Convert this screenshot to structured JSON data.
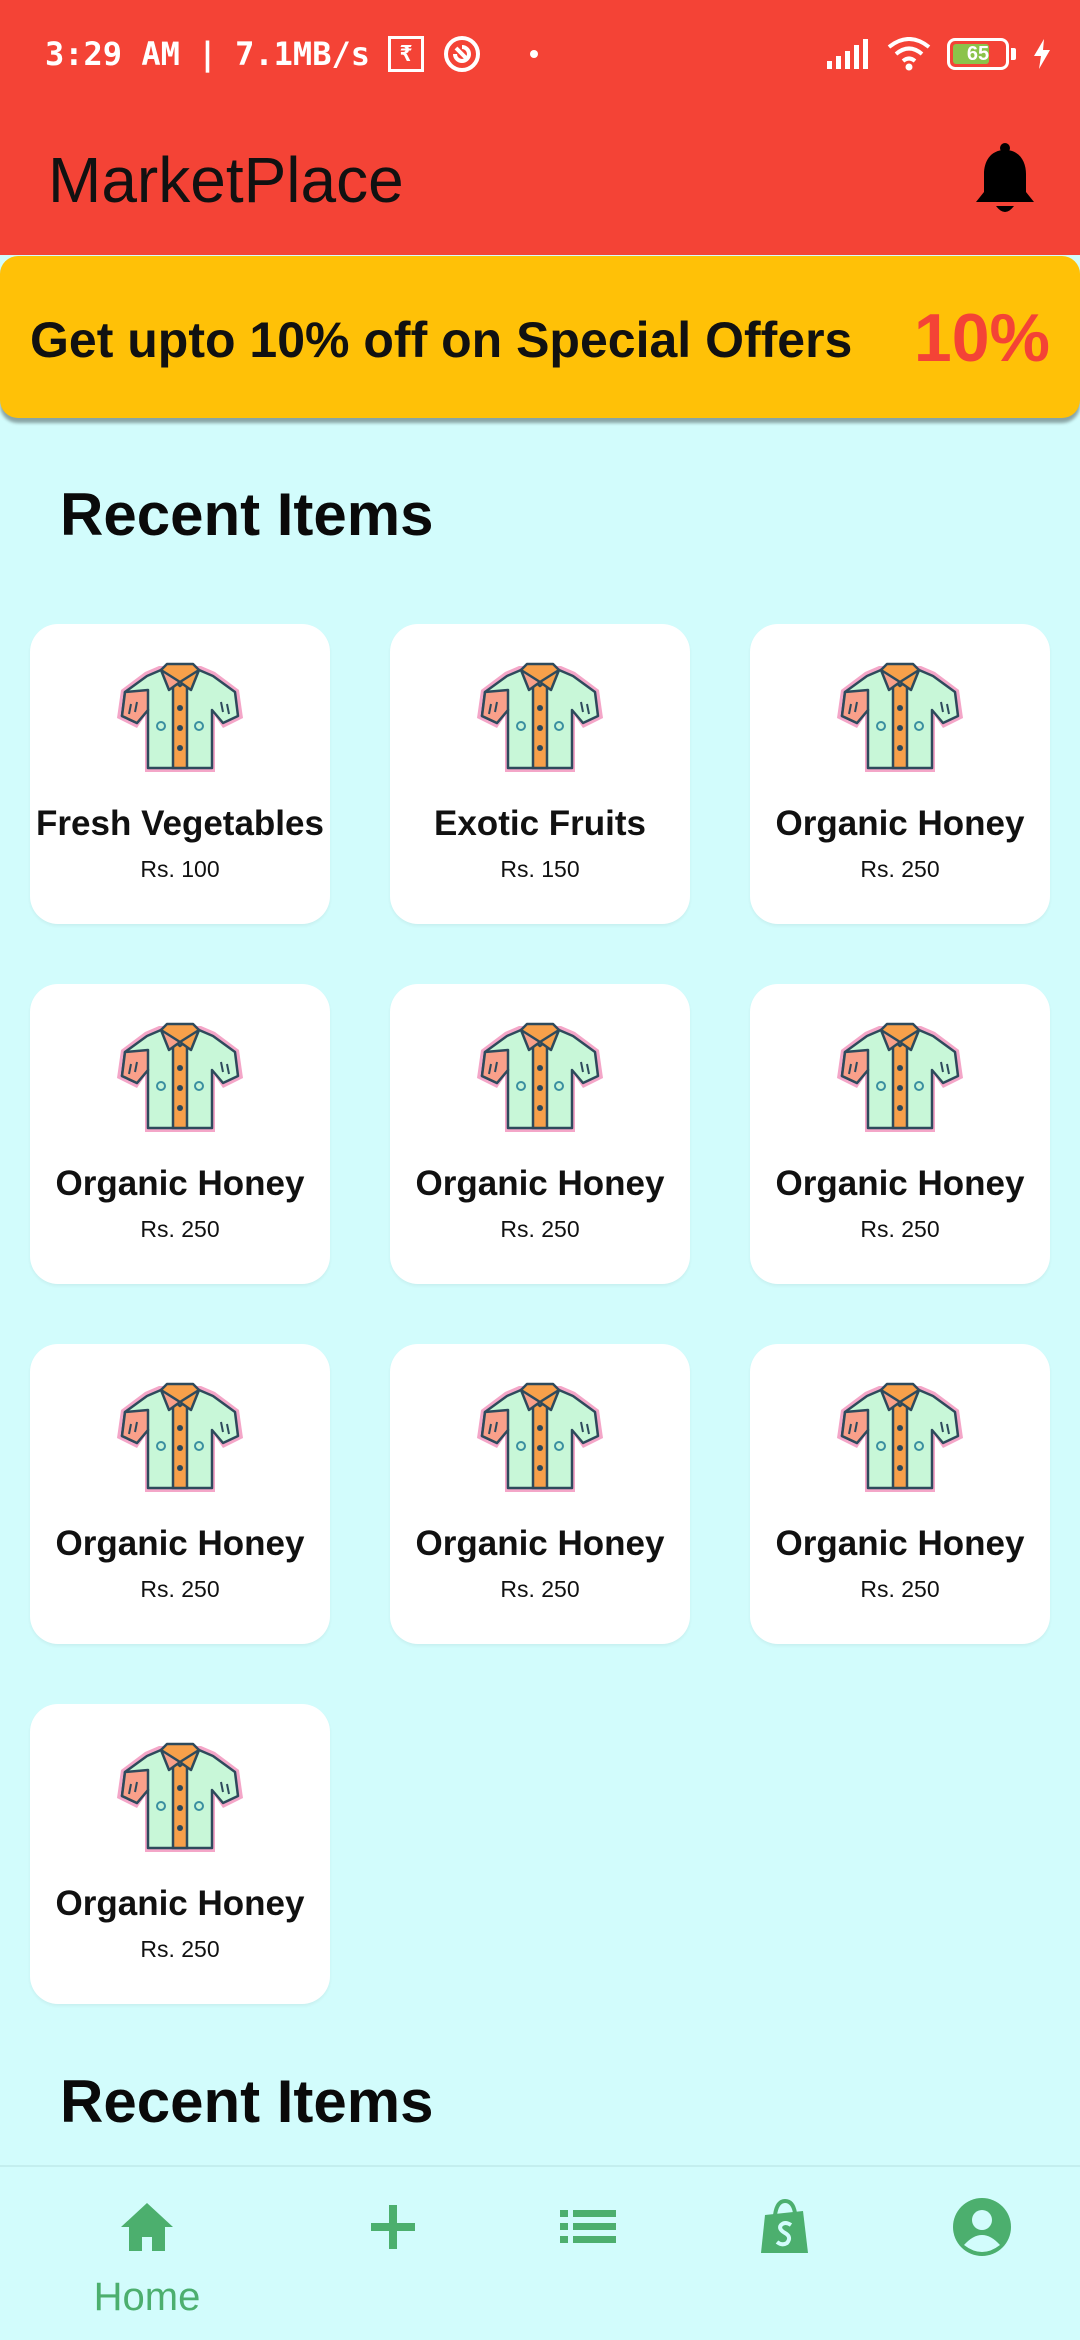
{
  "status_bar": {
    "time": "3:29 AM",
    "network_speed": "7.1MB/s",
    "battery_level": "65",
    "icons": [
      "rupee-notification-icon",
      "vpn-icon",
      "dot-icon",
      "signal-icon",
      "wifi-icon",
      "battery-icon",
      "charging-icon"
    ]
  },
  "app_bar": {
    "title": "MarketPlace",
    "notification_icon": "bell-icon"
  },
  "promo_banner": {
    "text": "Get upto 10% off on Special Offers",
    "percent": "10%"
  },
  "sections": [
    {
      "title": "Recent Items"
    },
    {
      "title": "Recent Items"
    }
  ],
  "items": [
    {
      "name": "Fresh Vegetables",
      "price": "Rs. 100",
      "icon": "shirt-icon"
    },
    {
      "name": "Exotic Fruits",
      "price": "Rs. 150",
      "icon": "shirt-icon"
    },
    {
      "name": "Organic Honey",
      "price": "Rs. 250",
      "icon": "shirt-icon"
    },
    {
      "name": "Organic Honey",
      "price": "Rs. 250",
      "icon": "shirt-icon"
    },
    {
      "name": "Organic Honey",
      "price": "Rs. 250",
      "icon": "shirt-icon"
    },
    {
      "name": "Organic Honey",
      "price": "Rs. 250",
      "icon": "shirt-icon"
    },
    {
      "name": "Organic Honey",
      "price": "Rs. 250",
      "icon": "shirt-icon"
    },
    {
      "name": "Organic Honey",
      "price": "Rs. 250",
      "icon": "shirt-icon"
    },
    {
      "name": "Organic Honey",
      "price": "Rs. 250",
      "icon": "shirt-icon"
    },
    {
      "name": "Organic Honey",
      "price": "Rs. 250",
      "icon": "shirt-icon"
    }
  ],
  "bottom_nav": {
    "items": [
      {
        "label": "Home",
        "icon": "home-icon",
        "active": true
      },
      {
        "label": "",
        "icon": "add-icon",
        "active": false
      },
      {
        "label": "",
        "icon": "list-icon",
        "active": false
      },
      {
        "label": "",
        "icon": "shopping-bag-icon",
        "active": false
      },
      {
        "label": "",
        "icon": "profile-icon",
        "active": false
      }
    ]
  },
  "colors": {
    "app_bar": "#f44336",
    "promo_banner": "#ffc107",
    "promo_percent": "#f44336",
    "background": "#d2fcfc",
    "nav_accent": "#4caf6e"
  }
}
